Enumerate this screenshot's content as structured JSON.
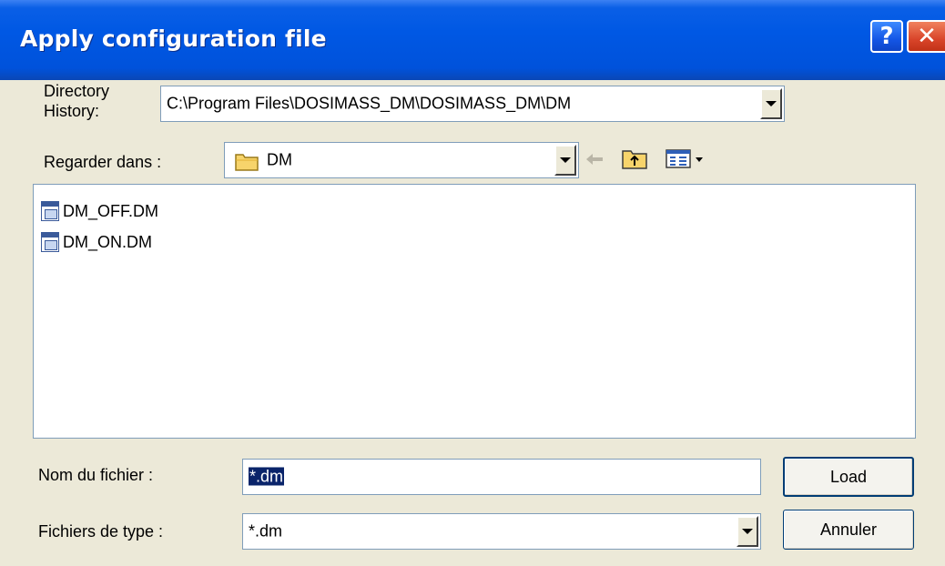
{
  "window": {
    "title": "Apply configuration file",
    "help_label": "?",
    "close_label": "✕"
  },
  "directory_history": {
    "label": "Directory\nHistory:",
    "value": "C:\\Program Files\\DOSIMASS_DM\\DOSIMASS_DM\\DM"
  },
  "look_in": {
    "label": "Regarder dans :",
    "value": "DM"
  },
  "files": [
    {
      "name": "DM_OFF.DM"
    },
    {
      "name": "DM_ON.DM"
    }
  ],
  "file_name": {
    "label": "Nom du fichier :",
    "value": "*.dm"
  },
  "file_type": {
    "label": "Fichiers de type :",
    "value": "*.dm"
  },
  "buttons": {
    "load": "Load",
    "cancel": "Annuler"
  },
  "icons": [
    "folder-icon",
    "back-arrow-icon",
    "up-folder-icon",
    "view-menu-icon",
    "file-icon",
    "chevron-down-icon"
  ]
}
